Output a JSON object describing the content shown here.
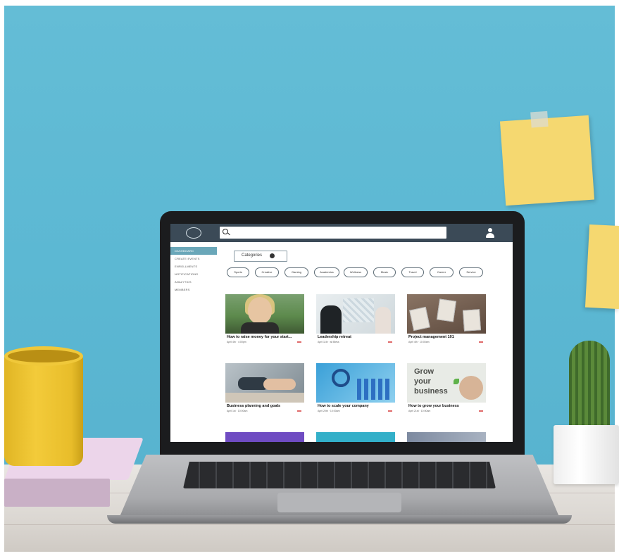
{
  "app": {
    "search": {
      "placeholder": ""
    },
    "sidebar": {
      "items": [
        {
          "label": "Dashboard"
        },
        {
          "label": "Create Events"
        },
        {
          "label": "Enrollments"
        },
        {
          "label": "Notifications"
        },
        {
          "label": "Analytics"
        },
        {
          "label": "Members"
        }
      ]
    },
    "category_select": {
      "label": "Categories"
    },
    "filter_chips": [
      {
        "label": "Sports"
      },
      {
        "label": "Creative"
      },
      {
        "label": "Gaming"
      },
      {
        "label": "Academics"
      },
      {
        "label": "Wellness"
      },
      {
        "label": "Music"
      },
      {
        "label": "Travel"
      },
      {
        "label": "Career"
      },
      {
        "label": "Service"
      }
    ],
    "cards": [
      {
        "title": "How to raise money for your start...",
        "meta": "April 4th · 4:00pm"
      },
      {
        "title": "Leadership retreat",
        "meta": "April 11th · all Bless"
      },
      {
        "title": "Project management 101",
        "meta": "April 4th · 10:00am"
      },
      {
        "title": "Business planning and goals",
        "meta": "April 1st · 10:00am"
      },
      {
        "title": "How to scale your company",
        "meta": "April 20th · 10:00am"
      },
      {
        "title": "How to grow your business",
        "meta": "April 21st · 10:00am"
      }
    ],
    "grow_thumb_words": [
      "Grow",
      "your",
      "business"
    ]
  },
  "colors": {
    "topbar": "#3b4a57",
    "sidebar_active": "#6aa7b9",
    "badge": "#e06b6b",
    "wall": "#5cb8d3"
  }
}
